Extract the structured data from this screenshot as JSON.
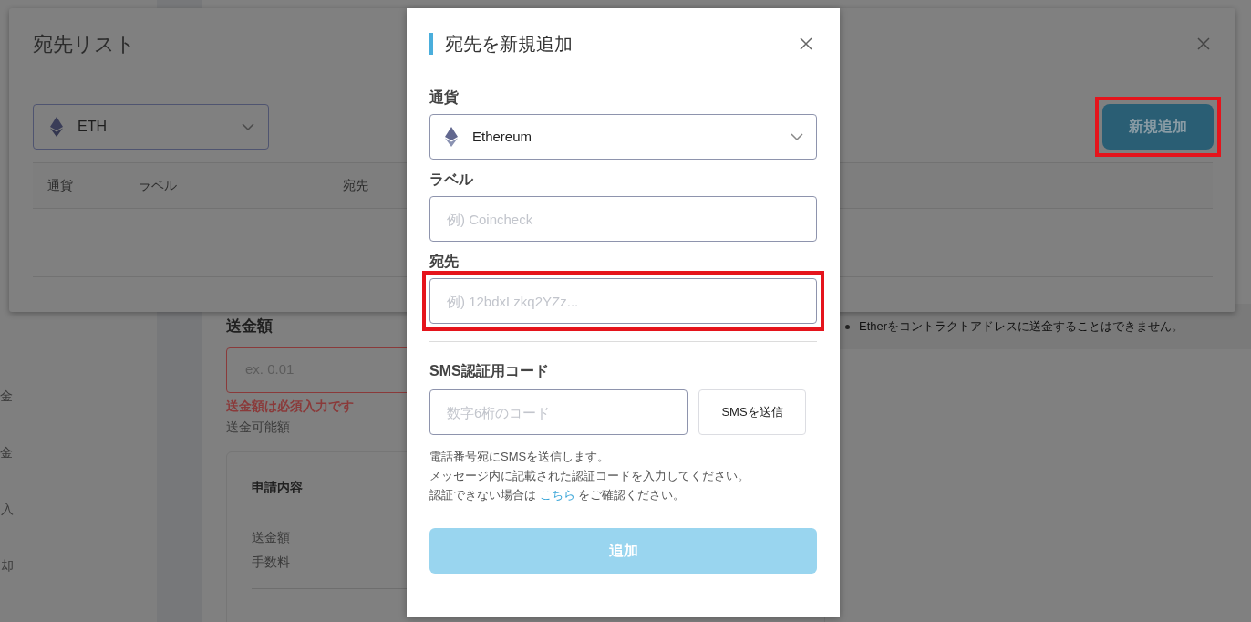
{
  "page": {
    "sidebar_items": [
      "金",
      "金",
      "入",
      "却"
    ],
    "amount": {
      "label": "送金額",
      "placeholder": "ex. 0.01",
      "error": "送金額は必須入力です",
      "available_label": "送金可能額"
    },
    "summary": {
      "title": "申請内容",
      "rows": [
        "送金額",
        "手数料"
      ]
    },
    "notice": "Etherをコントラクトアドレスに送金することはできません。"
  },
  "address_list": {
    "title": "宛先リスト",
    "currency_select": {
      "value": "ETH"
    },
    "add_button": {
      "label": "新規追加",
      "highlighted": true
    },
    "columns": [
      "通貨",
      "ラベル",
      "宛先"
    ]
  },
  "dialog": {
    "title": "宛先を新規追加",
    "fields": [
      {
        "kind": "select",
        "label": "通貨",
        "value": "Ethereum",
        "highlighted": false
      },
      {
        "kind": "input",
        "label": "ラベル",
        "placeholder": "例) Coincheck",
        "highlighted": false
      },
      {
        "kind": "input",
        "label": "宛先",
        "placeholder": "例) 12bdxLzkq2YZz...",
        "highlighted": true
      }
    ],
    "sms": {
      "label": "SMS認証用コード",
      "placeholder": "数字6桁のコード",
      "button": "SMSを送信",
      "help": [
        "電話番号宛にSMSを送信します。",
        "メッセージ内に記載された認証コードを入力してください。"
      ],
      "help_link_line": {
        "before": "認証できない場合は",
        "link": "こちら",
        "after": "をご確認ください。"
      }
    },
    "submit": {
      "label": "追加",
      "disabled": true
    }
  }
}
